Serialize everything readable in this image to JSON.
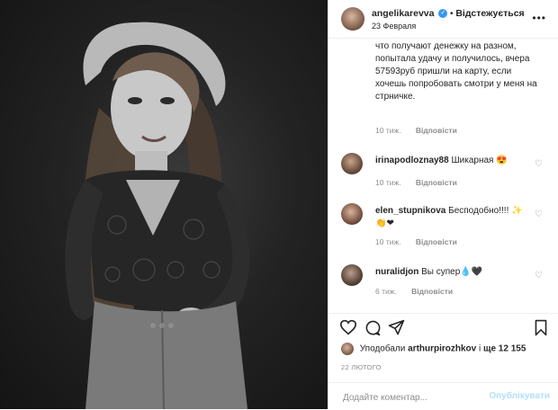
{
  "post": {
    "author": "angelikarevva",
    "follow_label": "Відстежується",
    "location": "23 Февраля",
    "more_icon": "more-horizontal-icon"
  },
  "caption": {
    "text": "что получают денежку на разном, попытала удачу и получилось, вчера 57593руб пришли на карту, если хочешь попробовать смотри у меня на стрничке.",
    "time": "10 тиж.",
    "reply": "Відповісти"
  },
  "comments": [
    {
      "user": "irinapodloznay88",
      "text": "Шикарная 😍",
      "time": "10 тиж.",
      "reply": "Відповісти"
    },
    {
      "user": "elen_stupnikova",
      "text": "Бесподобно!!!! ✨👏❤",
      "time": "10 тиж.",
      "reply": "Відповісти"
    },
    {
      "user": "nuralidjon",
      "text": "Вы супер💧🖤",
      "time": "6 тиж.",
      "reply": "Відповісти"
    }
  ],
  "likes": {
    "prefix": "Уподобали",
    "user": "arthurpirozhkov",
    "connector": "і",
    "count_text": "ще 12 155"
  },
  "date": "22 ЛЮТОГО",
  "add_comment": {
    "placeholder": "Додайте коментар...",
    "publish_label": "Опублікувати"
  },
  "colors": {
    "verified": "#3897f0",
    "publish": "#b2dffc",
    "muted": "#8e8e8e",
    "text": "#262626"
  }
}
